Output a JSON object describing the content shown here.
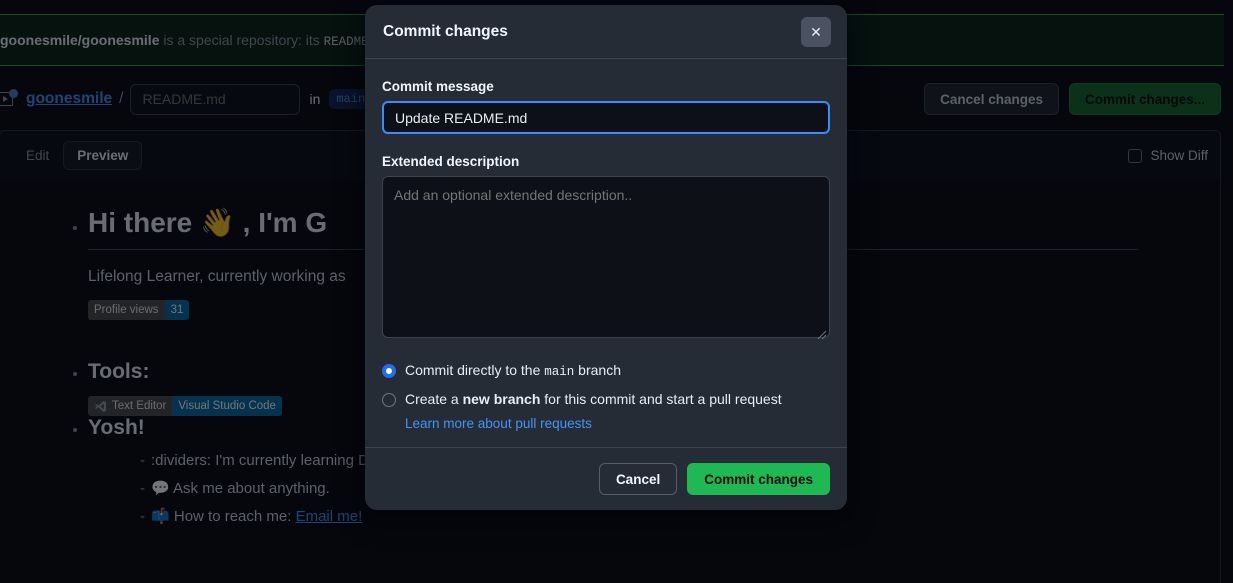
{
  "banner": {
    "repo_bold": "goonesmile/goonesmile",
    "text_mid": " is a special repository: its ",
    "code": "README.",
    "accent_color": "#2ea043"
  },
  "pathbar": {
    "owner": "goonesmile",
    "separator": "/",
    "filename_value": "",
    "filename_placeholder": "README.md",
    "in_word": "in",
    "branch": "main",
    "cancel_changes_label": "Cancel changes",
    "commit_changes_label": "Commit changes...",
    "repo_icon": "repository-icon"
  },
  "editor": {
    "tabs": [
      {
        "label": "Edit",
        "active": false
      },
      {
        "label": "Preview",
        "active": true
      }
    ],
    "show_diff_label": "Show Diff",
    "show_diff_checked": false
  },
  "readme": {
    "heading": "Hi there 👋 , I'm G",
    "intro": "Lifelong Learner, currently working as",
    "profile_badge": {
      "label": "Profile views",
      "value": "31"
    },
    "tools_heading": "Tools:",
    "tools_badge": {
      "icon": "vscode-icon",
      "label": "Text Editor",
      "value": "Visual Studio Code"
    },
    "yosh_heading": "Yosh!",
    "bullets": [
      {
        "dash": "-",
        "emoji": "",
        "text": ":dividers: I'm currently learning Data Analytics.",
        "link": ""
      },
      {
        "dash": "-",
        "emoji": "💬",
        "text": "Ask me about anything.",
        "link": ""
      },
      {
        "dash": "-",
        "emoji": "📫",
        "text": "How to reach me: ",
        "link": "Email me!"
      }
    ]
  },
  "modal": {
    "title": "Commit changes",
    "close_label": "✕",
    "commit_message_label": "Commit message",
    "commit_message_value": "Update README.md",
    "extended_description_label": "Extended description",
    "extended_description_value": "",
    "extended_description_placeholder": "Add an optional extended description..",
    "option_direct": {
      "pre": "Commit directly to the ",
      "code": "main",
      "post": " branch",
      "selected": true
    },
    "option_branch": {
      "pre": "Create a ",
      "bold": "new branch",
      "post": " for this commit and start a pull request",
      "selected": false
    },
    "learn_more_label": "Learn more about pull requests",
    "cancel_label": "Cancel",
    "commit_label": "Commit changes",
    "accent_green": "#1fb954",
    "focus_blue": "#388bfd"
  }
}
